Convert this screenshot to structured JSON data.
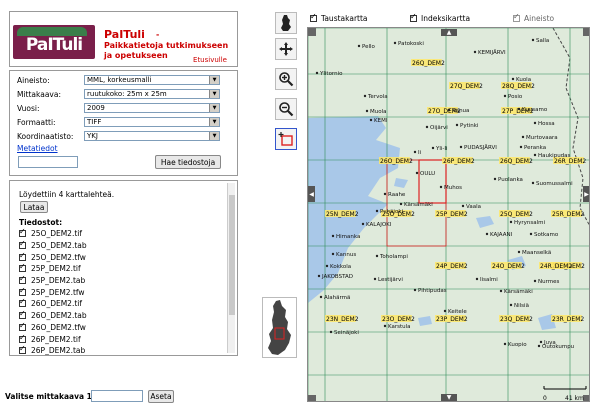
{
  "header": {
    "logo_text": "PaITuli",
    "brand_name": "PaITuli",
    "brand_dash": "-",
    "brand_subtitle": "Paikkatietoja tutkimukseen ja opetukseen",
    "home_link": "Etusivulle"
  },
  "form": {
    "fields": [
      {
        "label": "Aineisto:",
        "value": "MML, korkeusmalli"
      },
      {
        "label": "Mittakaava:",
        "value": "ruutukoko: 25m x 25m"
      },
      {
        "label": "Vuosi:",
        "value": "2009"
      },
      {
        "label": "Formaatti:",
        "value": "TIFF"
      },
      {
        "label": "Koordinaatisto:",
        "value": "YKJ"
      }
    ],
    "metadata_link": "Metatiedot",
    "coord_value": "",
    "fetch_button": "Hae tiedostoja"
  },
  "results": {
    "found_text": "Löydettiin 4 karttalehteä.",
    "load_button": "Lataa",
    "files_heading": "Tiedostot:",
    "files": [
      "25O_DEM2.tif",
      "25O_DEM2.tab",
      "25O_DEM2.tfw",
      "25P_DEM2.tif",
      "25P_DEM2.tab",
      "25P_DEM2.tfw",
      "26O_DEM2.tif",
      "26O_DEM2.tab",
      "26O_DEM2.tfw",
      "26P_DEM2.tif",
      "26P_DEM2.tab"
    ]
  },
  "scale": {
    "label": "Valitse mittakaava 1:",
    "value": "",
    "button": "Aseta"
  },
  "layers": [
    {
      "label": "Taustakartta",
      "checked": true
    },
    {
      "label": "Indeksikartta",
      "checked": true
    },
    {
      "label": "Aineisto",
      "checked": true,
      "disabled": true
    }
  ],
  "tools": [
    "finland-silhouette-icon",
    "pan-icon",
    "zoom-in-icon",
    "zoom-out-icon",
    "select-frame-icon"
  ],
  "map": {
    "sheets": [
      "26Q_DEM2",
      "27Q_DEM2",
      "28Q_DEM2",
      "27O_DEM2",
      "27P_DEM2",
      "26O_DEM2",
      "26P_DEM2",
      "26Q_DEM2",
      "26R_DEM2",
      "25N_DEM2",
      "25O_DEM2",
      "25P_DEM2",
      "25Q_DEM2",
      "25R_DEM2",
      "24O_DEM2",
      "24P_DEM2",
      "24Q_DEM2",
      "24R_DEM2",
      "23N_DEM2",
      "23O_DEM2",
      "23P_DEM2",
      "23Q_DEM2",
      "23R_DEM2"
    ],
    "places": [
      "Patokoski",
      "Salla",
      "Pello",
      "KEMIJÄRVI",
      "Ylitornio",
      "Kuola",
      "Tervola",
      "Posio",
      "Muola",
      "Ranua",
      "Kuusamo",
      "KEMI",
      "Pytinki",
      "Hossa",
      "Oijärvi",
      "Murtovaara",
      "Yli-Ii",
      "PUDASJÄRVI",
      "Peranka",
      "Ii",
      "Haukipudas",
      "OULU",
      "Puolanka",
      "Suomussalmi",
      "Raahe",
      "Muhos",
      "Kärsämäki",
      "Hyrynsalmi",
      "Pyhäjoki",
      "Vaala",
      "KALAJOKI",
      "KAJAANI",
      "Sotkamo",
      "Himanka",
      "Kannus",
      "Toholampi",
      "Maanselkä",
      "Kokkola",
      "Nurmes",
      "Kuopio",
      "Kärsämäki",
      "Pihtipudas",
      "JAKOBSTAD",
      "Lestijärvi",
      "Iisalmi",
      "Alahärmä",
      "Keitele",
      "Nilsiä",
      "Seinäjoki",
      "Karstula",
      "Juva",
      "Outokumpu"
    ],
    "scale_zero": "0",
    "scale_end": "41 km",
    "colors": {
      "land": "#dfeadb",
      "sea": "#a9c8e8",
      "grid": "#2e8b57",
      "selected": "#dd2222",
      "sheet_label": "#ccaa00"
    }
  }
}
